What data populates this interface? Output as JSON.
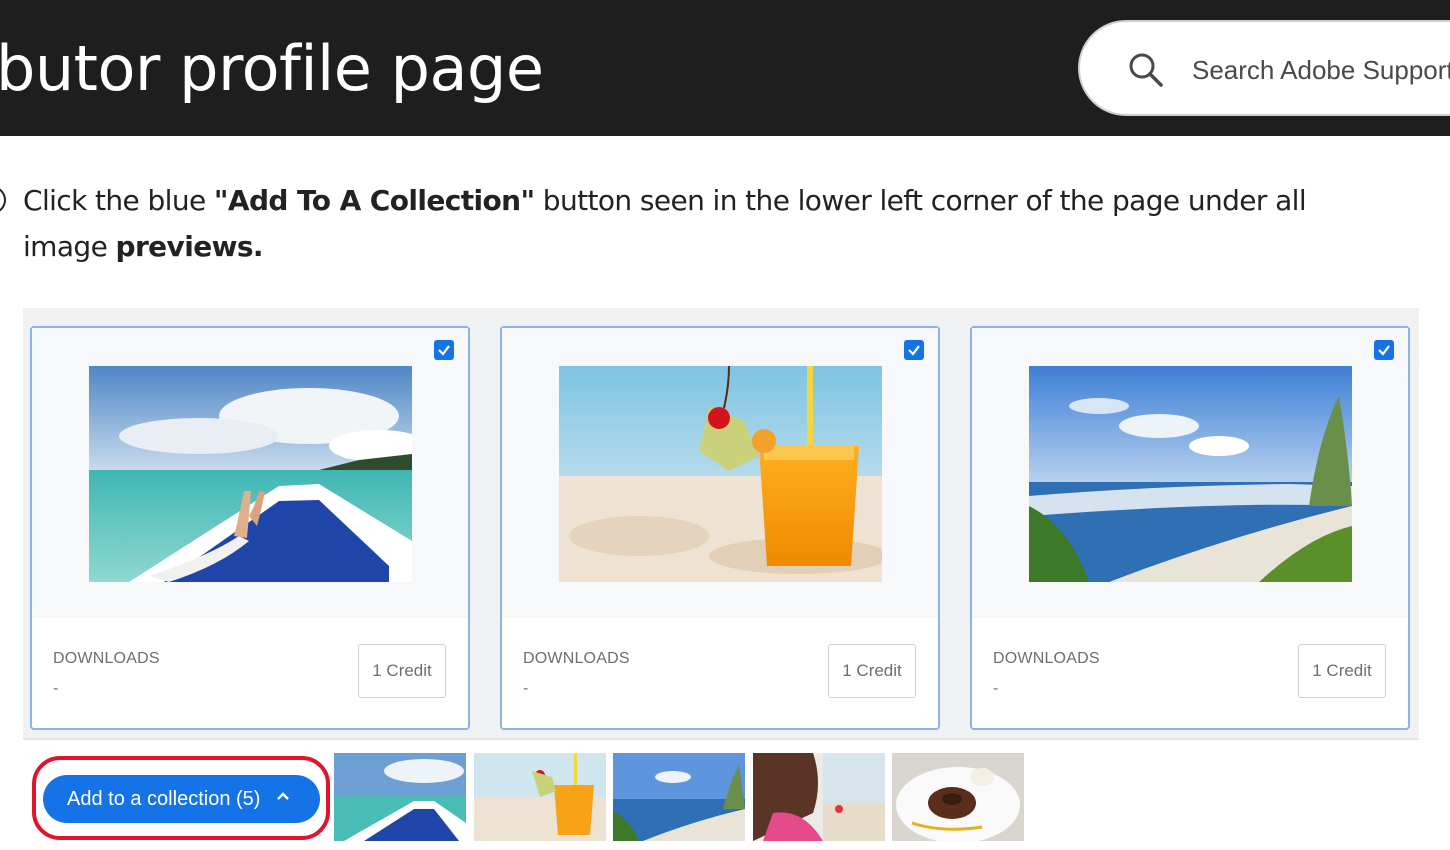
{
  "header": {
    "title": "butor profile page",
    "search_placeholder": "Search Adobe Support"
  },
  "instruction": {
    "prefix": "Click the blue ",
    "bold_button": "\"Add To A Collection\"",
    "middle": " button seen in the lower left corner of the page under all image ",
    "bold_tail": "previews."
  },
  "cards": [
    {
      "label": "DOWNLOADS",
      "value": "-",
      "credit": "1 Credit",
      "checked": true,
      "image": "boat-ocean-image"
    },
    {
      "label": "DOWNLOADS",
      "value": "-",
      "credit": "1 Credit",
      "checked": true,
      "image": "juice-beach-image"
    },
    {
      "label": "DOWNLOADS",
      "value": "-",
      "credit": "1 Credit",
      "checked": true,
      "image": "coastline-image"
    }
  ],
  "collection_bar": {
    "button_label": "Add to a collection (5)",
    "thumbnails": [
      "boat-ocean-thumb",
      "juice-beach-thumb",
      "coastline-thumb",
      "girl-beach-thumb",
      "dessert-plate-thumb"
    ]
  },
  "colors": {
    "header_bg": "#1e1e1e",
    "accent_blue": "#1473e6",
    "highlight_red": "#e0142b",
    "card_border": "#8fb3e6"
  }
}
